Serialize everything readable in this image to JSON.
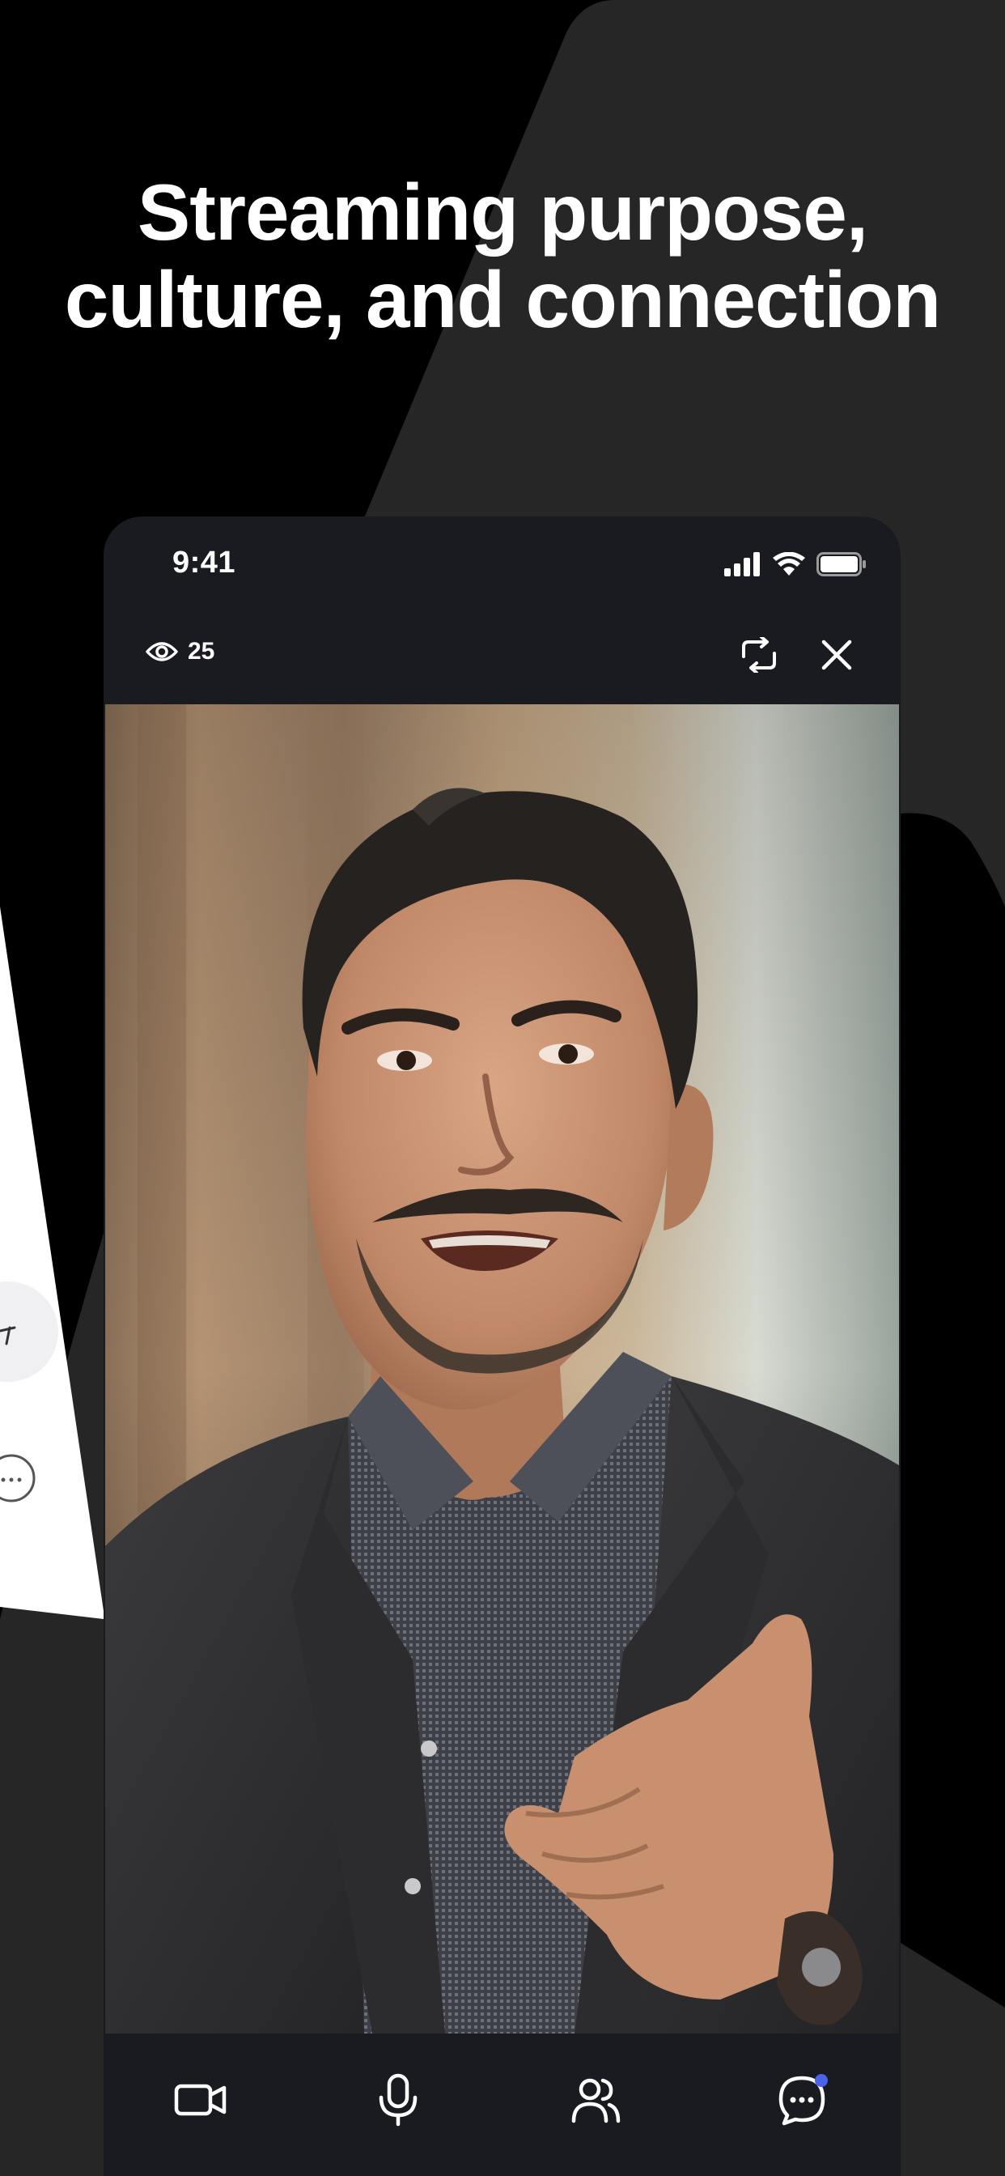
{
  "headline": {
    "line1": "Streaming purpose,",
    "line2": "culture, and connection"
  },
  "status_bar": {
    "time": "9:41"
  },
  "stream": {
    "viewer_count": "25"
  },
  "colors": {
    "background": "#000000",
    "shape": "#262626",
    "phone_body": "#1a1b20",
    "notification_dot": "#4a63e8",
    "text": "#ffffff"
  },
  "icons": {
    "viewers": "eye-icon",
    "switch_camera": "switch-camera-icon",
    "close": "close-icon",
    "video": "video-camera-icon",
    "mic": "microphone-icon",
    "participants": "people-icon",
    "chat": "chat-bubble-icon"
  }
}
